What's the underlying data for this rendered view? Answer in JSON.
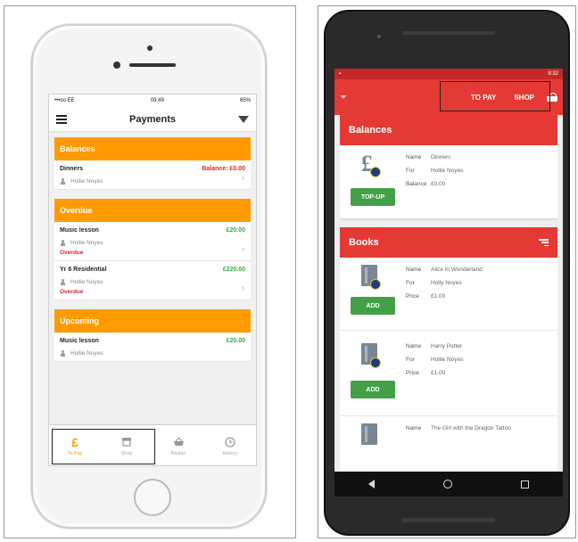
{
  "ios": {
    "status": {
      "carrier": "•••oo EE",
      "time": "09:49",
      "battery": "65%"
    },
    "nav_title": "Payments",
    "sections": [
      {
        "header": "Balances",
        "items": [
          {
            "name": "Dinners",
            "amount": "Balance: £0.00",
            "amount_color": "red",
            "person": "Hollie Noyes",
            "status": ""
          }
        ]
      },
      {
        "header": "Overdue",
        "items": [
          {
            "name": "Music lesson",
            "amount": "£20.00",
            "amount_color": "green",
            "person": "Hollie Noyes",
            "status": "Overdue"
          },
          {
            "name": "Yr 6 Residential",
            "amount": "£220.00",
            "amount_color": "green",
            "person": "Hollie Noyes",
            "status": "Overdue"
          }
        ]
      },
      {
        "header": "Upcoming",
        "items": [
          {
            "name": "Music lesson",
            "amount": "£20.00",
            "amount_color": "green",
            "person": "Hollie Noyes",
            "status": ""
          }
        ]
      }
    ],
    "tabs": [
      {
        "label": "To Pay",
        "icon": "£",
        "active": true
      },
      {
        "label": "Shop",
        "icon": "shop-icon",
        "active": false
      },
      {
        "label": "Basket",
        "icon": "basket-icon",
        "active": false
      },
      {
        "label": "History",
        "icon": "history-icon",
        "active": false
      }
    ]
  },
  "android": {
    "status": {
      "time": "8:32"
    },
    "tabs": {
      "to_pay": "TO PAY",
      "shop": "SHOP"
    },
    "balances": {
      "header": "Balances",
      "item": {
        "name_label": "Name",
        "name": "Dinners",
        "for_label": "For",
        "for": "Hollie Noyes",
        "balance_label": "Balance",
        "balance": "£0.00",
        "button": "TOP-UP"
      }
    },
    "books": {
      "header": "Books",
      "items": [
        {
          "name_label": "Name",
          "name": "Alice in Wonderland",
          "for_label": "For",
          "for": "Holly Noyes",
          "price_label": "Price",
          "price": "£1.00",
          "button": "ADD"
        },
        {
          "name_label": "Name",
          "name": "Harry Potter",
          "for_label": "For",
          "for": "Hollie Noyes",
          "price_label": "Price",
          "price": "£1.00",
          "button": "ADD"
        },
        {
          "name_label": "Name",
          "name": "The Girl with the Dragon Tattoo",
          "for_label": "",
          "for": "",
          "price_label": "",
          "price": "",
          "button": ""
        }
      ]
    }
  },
  "colors": {
    "ios_accent": "#ff9a00",
    "android_primary": "#e53935",
    "success": "#43a047",
    "alert": "#d9252c"
  }
}
